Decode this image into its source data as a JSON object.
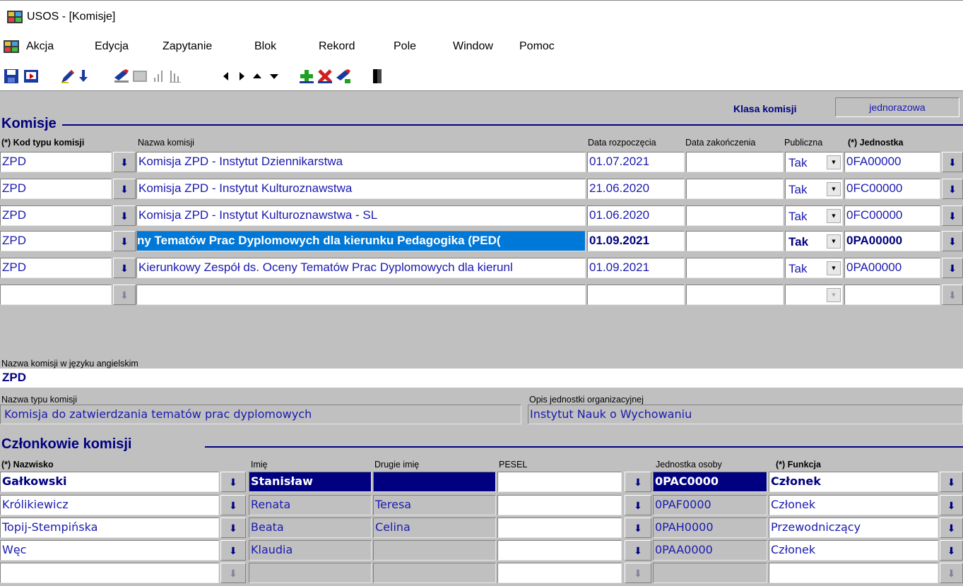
{
  "window": {
    "title": "USOS - [Komisje]"
  },
  "menu": {
    "items": [
      "Akcja",
      "Edycja",
      "Zapytanie",
      "Blok",
      "Rekord",
      "Pole",
      "Window",
      "Pomoc"
    ]
  },
  "toolbar": {
    "icons": [
      "save-icon",
      "exit-icon",
      "edit-icon",
      "list-of-values-icon",
      "enter-query-icon",
      "execute-query-icon",
      "chart-icon",
      "count-icon",
      "previous-block-icon",
      "next-block-icon",
      "previous-record-icon",
      "next-record-icon",
      "insert-record-icon",
      "delete-record-icon",
      "duplicate-record-icon",
      "exit-door-icon"
    ]
  },
  "komisje": {
    "title": "Komisje",
    "klasa_label": "Klasa komisji",
    "klasa_value": "jednorazowa",
    "headers": {
      "kod": "(*) Kod typu komisji",
      "nazwa": "Nazwa komisji",
      "data_rozp": "Data rozpoczęcia",
      "data_zak": "Data zakończenia",
      "publiczna": "Publiczna",
      "jednostka": "(*) Jednostka"
    },
    "rows": [
      {
        "kod": "ZPD",
        "nazwa": "Komisja ZPD - Instytut Dziennikarstwa",
        "data_rozp": "01.07.2021",
        "data_zak": "",
        "publiczna": "Tak",
        "jednostka": "0FA00000"
      },
      {
        "kod": "ZPD",
        "nazwa": "Komisja ZPD - Instytut Kulturoznawstwa",
        "data_rozp": "21.06.2020",
        "data_zak": "",
        "publiczna": "Tak",
        "jednostka": "0FC00000"
      },
      {
        "kod": "ZPD",
        "nazwa": "Komisja ZPD - Instytut Kulturoznawstwa - SL",
        "data_rozp": "01.06.2020",
        "data_zak": "",
        "publiczna": "Tak",
        "jednostka": "0FC00000"
      },
      {
        "kod": "ZPD",
        "nazwa": "ny Tematów Prac Dyplomowych dla kierunku Pedagogika (PED(",
        "data_rozp": "01.09.2021",
        "data_zak": "",
        "publiczna": "Tak",
        "jednostka": "0PA00000"
      },
      {
        "kod": "ZPD",
        "nazwa": "Kierunkowy Zespół ds. Oceny Tematów Prac Dyplomowych dla kierunl",
        "data_rozp": "01.09.2021",
        "data_zak": "",
        "publiczna": "Tak",
        "jednostka": "0PA00000"
      },
      {
        "kod": "",
        "nazwa": "",
        "data_rozp": "",
        "data_zak": "",
        "publiczna": "",
        "jednostka": ""
      }
    ]
  },
  "details": {
    "nazwa_ang_label": "Nazwa komisji w języku angielskim",
    "nazwa_ang_value": "ZPD",
    "nazwa_typu_label": "Nazwa typu komisji",
    "nazwa_typu_value": "Komisja do zatwierdzania tematów prac dyplomowych",
    "opis_jedn_label": "Opis jednostki organizacyjnej",
    "opis_jedn_value": "Instytut Nauk o Wychowaniu"
  },
  "czlonkowie": {
    "title": "Członkowie komisji",
    "headers": {
      "nazwisko": "(*) Nazwisko",
      "imie": "Imię",
      "drugie": "Drugie imię",
      "pesel": "PESEL",
      "jednostka": "Jednostka osoby",
      "funkcja": "(*) Funkcja"
    },
    "rows": [
      {
        "nazwisko": "Gałkowski",
        "imie": "Stanisław",
        "drugie": "",
        "pesel": "",
        "jednostka": "0PAC0000",
        "funkcja": "Członek"
      },
      {
        "nazwisko": "Królikiewicz",
        "imie": "Renata",
        "drugie": "Teresa",
        "pesel": "",
        "jednostka": "0PAF0000",
        "funkcja": "Członek"
      },
      {
        "nazwisko": "Topij-Stempińska",
        "imie": "Beata",
        "drugie": "Celina",
        "pesel": "",
        "jednostka": "0PAH0000",
        "funkcja": "Przewodniczący"
      },
      {
        "nazwisko": "Węc",
        "imie": "Klaudia",
        "drugie": "",
        "pesel": "",
        "jednostka": "0PAA0000",
        "funkcja": "Członek"
      },
      {
        "nazwisko": "",
        "imie": "",
        "drugie": "",
        "pesel": "",
        "jednostka": "",
        "funkcja": ""
      }
    ]
  },
  "colors": {
    "accent": "#000080",
    "field_text": "#1a1ab0",
    "background": "#c0c0c0",
    "highlight": "#0078d7"
  }
}
